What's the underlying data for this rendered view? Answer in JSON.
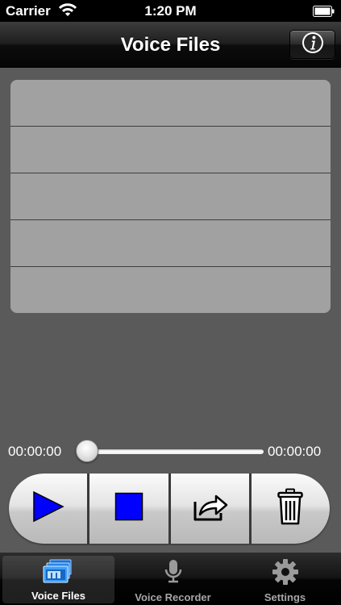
{
  "status_bar": {
    "carrier": "Carrier",
    "time": "1:20 PM"
  },
  "nav_bar": {
    "title": "Voice Files",
    "info_button_icon": "info-icon"
  },
  "file_list": {
    "rows": [
      "",
      "",
      "",
      "",
      ""
    ]
  },
  "player": {
    "elapsed": "00:00:00",
    "total": "00:00:00",
    "progress": 0,
    "buttons": [
      {
        "name": "play-button",
        "icon": "play-icon",
        "color": "#0000ff"
      },
      {
        "name": "stop-button",
        "icon": "stop-icon",
        "color": "#0000ff"
      },
      {
        "name": "share-button",
        "icon": "share-icon"
      },
      {
        "name": "delete-button",
        "icon": "trash-icon"
      }
    ]
  },
  "tab_bar": {
    "tabs": [
      {
        "label": "Voice Files",
        "icon": "voice-files-icon",
        "active": true
      },
      {
        "label": "Voice Recorder",
        "icon": "microphone-icon",
        "active": false
      },
      {
        "label": "Settings",
        "icon": "gear-icon",
        "active": false
      }
    ]
  }
}
